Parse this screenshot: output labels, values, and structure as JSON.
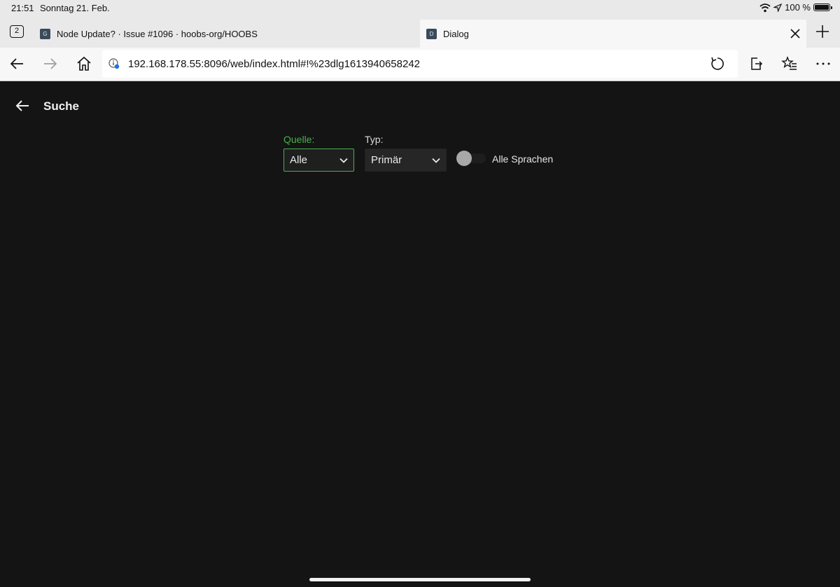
{
  "status_bar": {
    "time": "21:51",
    "date": "Sonntag 21. Feb.",
    "battery": "100 %",
    "icons": [
      "wifi-icon",
      "location-icon",
      "battery-icon"
    ]
  },
  "tabs": {
    "count": "2",
    "items": [
      {
        "label": "Node Update? · Issue #1096 · hoobs-org/HOOBS",
        "favicon": "G",
        "active": false
      },
      {
        "label": "Dialog",
        "favicon": "D",
        "active": true
      }
    ]
  },
  "toolbar": {
    "url": "192.168.178.55:8096/web/index.html#!%23dlg1613940658242",
    "icons": [
      "back-icon",
      "forward-icon",
      "home-icon",
      "site-info-icon",
      "reload-icon",
      "share-icon",
      "favorites-icon",
      "more-icon"
    ]
  },
  "page": {
    "title": "Suche",
    "source": {
      "label": "Quelle:",
      "value": "Alle"
    },
    "type": {
      "label": "Typ:",
      "value": "Primär"
    },
    "all_languages": {
      "label": "Alle Sprachen",
      "enabled": false
    }
  },
  "colors": {
    "background": "#141414",
    "accent": "#4caf50",
    "browser_chrome": "#e9e9ea"
  }
}
